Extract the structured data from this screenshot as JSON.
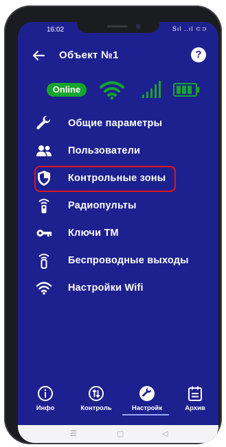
{
  "status_bar": {
    "time": "16:02",
    "signal_text": "Sıl ..ıl ⊂⊃"
  },
  "header": {
    "title": "Объект №1",
    "help_label": "?"
  },
  "status": {
    "online_label": "Online",
    "online_color": "#16a52c",
    "wifi_color": "#16a52c",
    "signal_color": "#16a52c",
    "battery_color": "#16a52c"
  },
  "menu": {
    "items": [
      {
        "label": "Общие параметры",
        "icon": "wrench-icon"
      },
      {
        "label": "Пользователи",
        "icon": "users-icon"
      },
      {
        "label": "Контрольные зоны",
        "icon": "shield-icon",
        "highlighted": true
      },
      {
        "label": "Радиопульты",
        "icon": "remote-icon"
      },
      {
        "label": "Ключи ТМ",
        "icon": "key-icon"
      },
      {
        "label": "Беспроводные выходы",
        "icon": "wireless-output-icon"
      },
      {
        "label": "Настройки Wifi",
        "icon": "wifi-icon"
      }
    ],
    "highlight_color": "#e0141f"
  },
  "bottom_nav": {
    "items": [
      {
        "label": "Инфо",
        "icon": "info-icon"
      },
      {
        "label": "Контроль",
        "icon": "control-icon"
      },
      {
        "label": "Настройк",
        "icon": "settings-wrench-icon",
        "active": true
      },
      {
        "label": "Архив",
        "icon": "archive-icon"
      }
    ]
  },
  "system_nav": {
    "menu": "☰",
    "home": "▢",
    "back": "◁"
  }
}
